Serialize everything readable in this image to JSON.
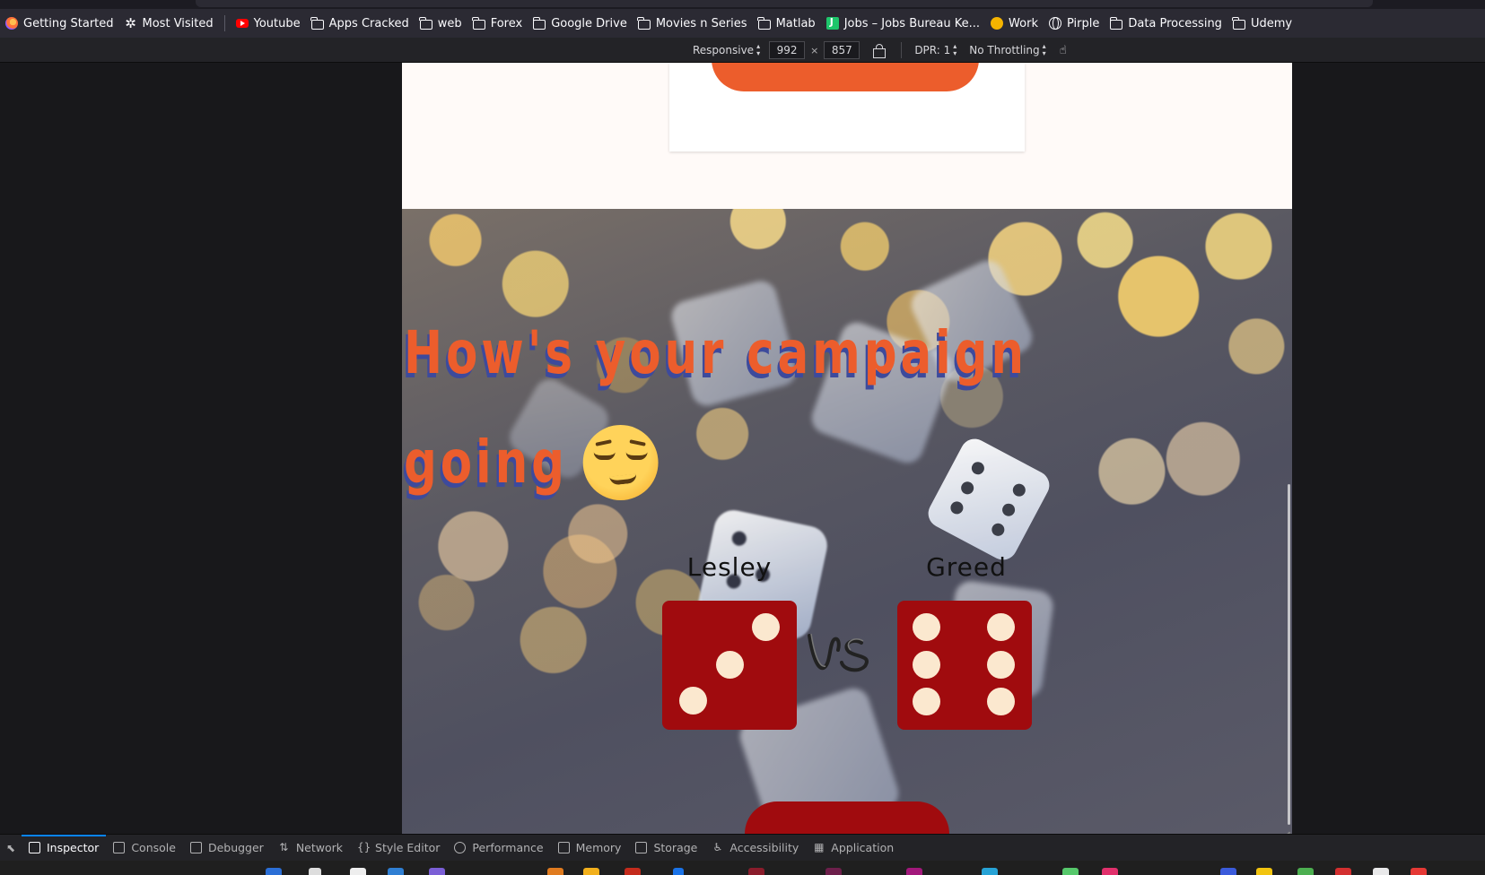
{
  "bookmarks": [
    {
      "label": "Getting Started",
      "icon": "firefox-icon"
    },
    {
      "label": "Most Visited",
      "icon": "gear-icon"
    },
    {
      "label": "Youtube",
      "icon": "youtube-icon"
    },
    {
      "label": "Apps Cracked",
      "icon": "folder-icon"
    },
    {
      "label": "web",
      "icon": "folder-icon"
    },
    {
      "label": "Forex",
      "icon": "folder-icon"
    },
    {
      "label": "Google Drive",
      "icon": "folder-icon"
    },
    {
      "label": "Movies n Series",
      "icon": "folder-icon"
    },
    {
      "label": "Matlab",
      "icon": "folder-icon"
    },
    {
      "label": "Jobs – Jobs Bureau Ke...",
      "icon": "jobs-icon"
    },
    {
      "label": "Work",
      "icon": "work-icon"
    },
    {
      "label": "Pirple",
      "icon": "globe-icon"
    },
    {
      "label": "Data Processing",
      "icon": "folder-icon"
    },
    {
      "label": "Udemy",
      "icon": "folder-icon"
    }
  ],
  "rdm": {
    "device": "Responsive",
    "width": "992",
    "height": "857",
    "dpr": "DPR: 1",
    "throttling": "No Throttling"
  },
  "page": {
    "headline_line1": "How's your campaign",
    "headline_line2": "going",
    "emoji": "relieved-face-emoji",
    "player1_name": "Lesley",
    "player2_name": "Greed",
    "player1_die": 3,
    "player2_die": 6,
    "vs_text": "vs",
    "colors": {
      "accent_orange": "#ec5d2c",
      "headline_shadow": "#3d4a9c",
      "dice_red": "#a00b0e",
      "pip_cream": "#fbe8cf",
      "page_bg": "#fffaf8"
    }
  },
  "devtools": {
    "tabs": [
      {
        "label": "Inspector",
        "icon": "inspector-icon",
        "active": true
      },
      {
        "label": "Console",
        "icon": "console-icon"
      },
      {
        "label": "Debugger",
        "icon": "debugger-icon"
      },
      {
        "label": "Network",
        "icon": "network-icon"
      },
      {
        "label": "Style Editor",
        "icon": "style-editor-icon"
      },
      {
        "label": "Performance",
        "icon": "performance-icon"
      },
      {
        "label": "Memory",
        "icon": "memory-icon"
      },
      {
        "label": "Storage",
        "icon": "storage-icon"
      },
      {
        "label": "Accessibility",
        "icon": "accessibility-icon"
      },
      {
        "label": "Application",
        "icon": "application-icon"
      }
    ]
  }
}
